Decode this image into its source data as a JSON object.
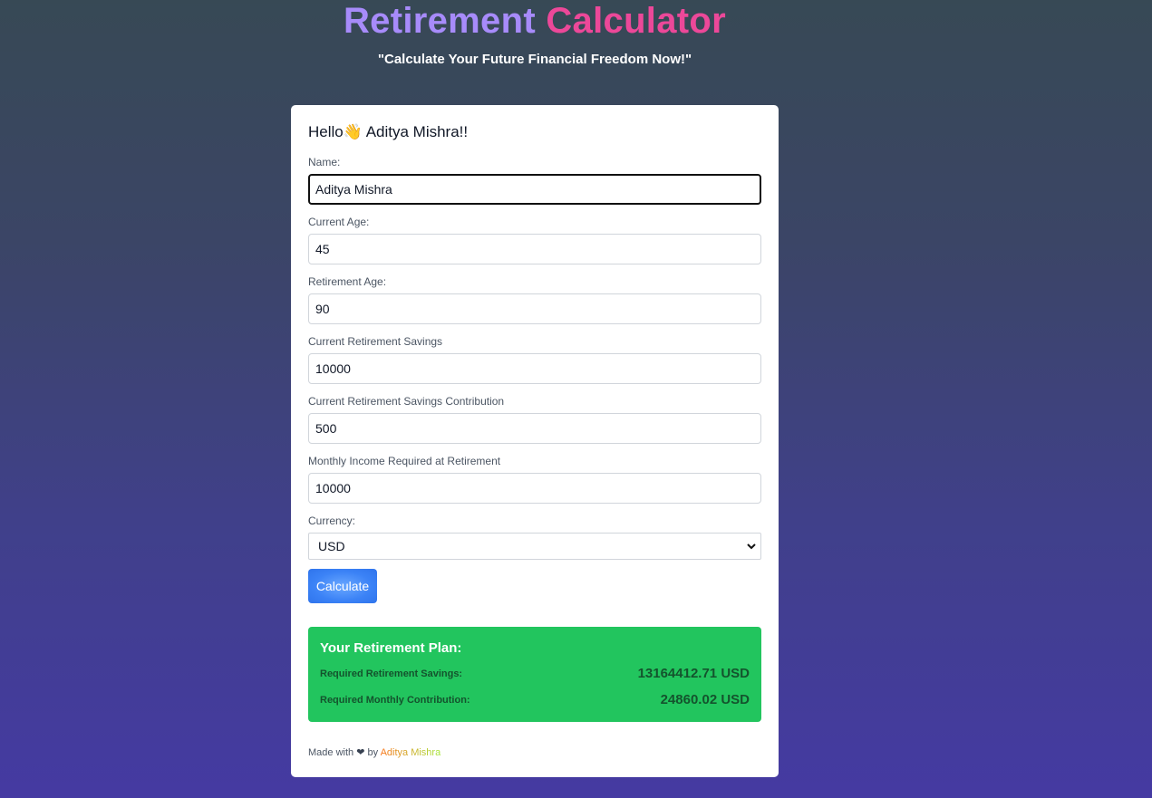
{
  "header": {
    "title_part1": "Retirement",
    "title_part2": "Calculator",
    "subtitle": "\"Calculate Your Future Financial Freedom Now!\""
  },
  "greeting": "Hello👋 Aditya Mishra!!",
  "form": {
    "name": {
      "label": "Name:",
      "value": "Aditya Mishra"
    },
    "current_age": {
      "label": "Current Age:",
      "value": "45"
    },
    "retirement_age": {
      "label": "Retirement Age:",
      "value": "90"
    },
    "current_savings": {
      "label": "Current Retirement Savings",
      "value": "10000"
    },
    "savings_contribution": {
      "label": "Current Retirement Savings Contribution",
      "value": "500"
    },
    "monthly_income": {
      "label": "Monthly Income Required at Retirement",
      "value": "10000"
    },
    "currency": {
      "label": "Currency:",
      "value": "USD"
    },
    "calculate_label": "Calculate"
  },
  "plan": {
    "title": "Your Retirement Plan:",
    "required_savings_label": "Required Retirement Savings:",
    "required_savings_value": "13164412.71 USD",
    "monthly_contribution_label": "Required Monthly Contribution:",
    "monthly_contribution_value": "24860.02 USD"
  },
  "footer": {
    "prefix": "Made with",
    "heart": "❤",
    "by": "by",
    "author": "Aditya Mishra"
  },
  "colors": {
    "title_gradient_start": "#a78bfa",
    "title_gradient_end": "#ec4899",
    "button": "#3b82f6",
    "plan_background": "#22c55e"
  }
}
